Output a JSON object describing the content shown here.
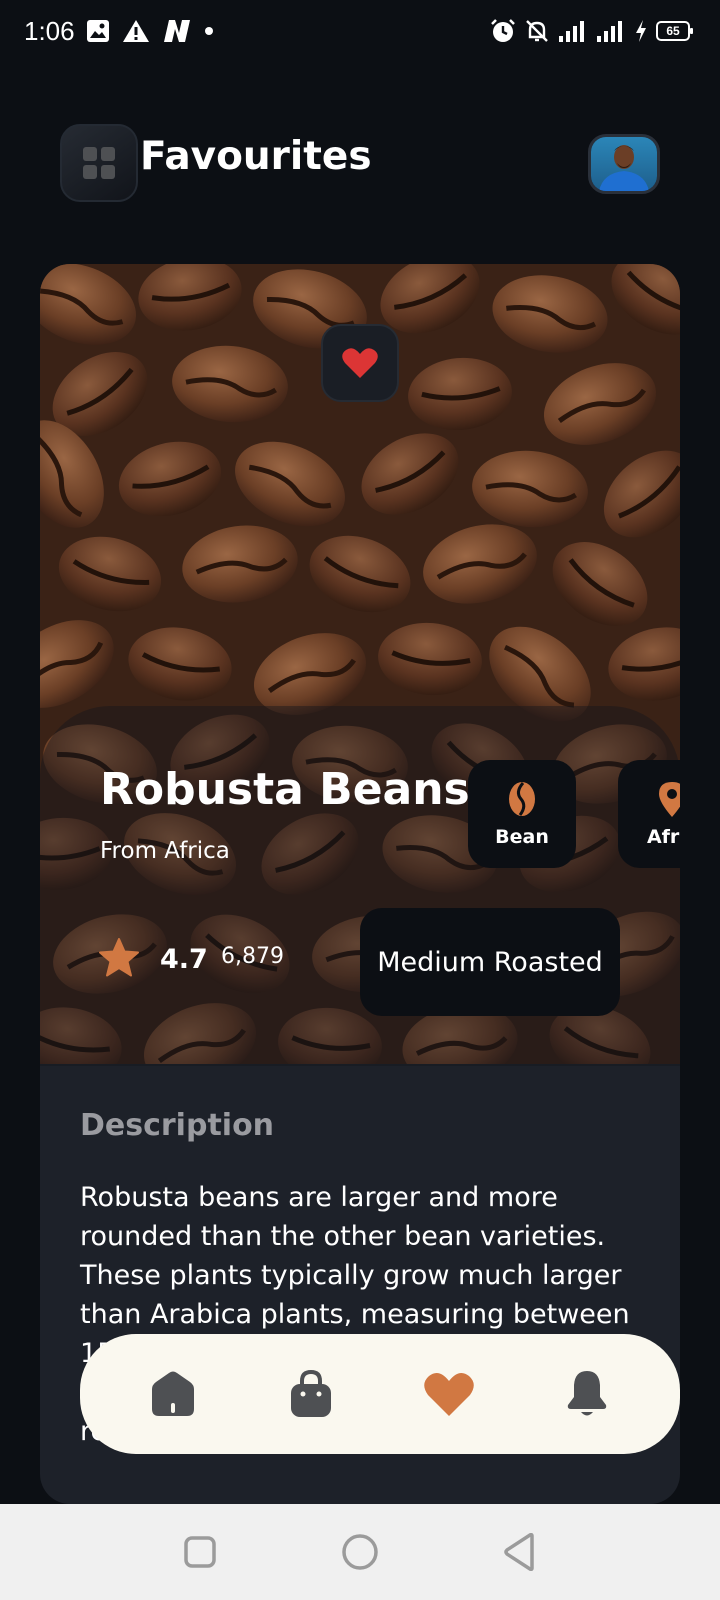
{
  "status_bar": {
    "time": "1:06",
    "battery": "65",
    "left_icons": [
      "image-icon",
      "alert-icon",
      "n-app-icon",
      "dot-icon"
    ],
    "right_icons": [
      "alarm-icon",
      "bell-off-icon",
      "signal-icon",
      "signal-icon",
      "charging-icon",
      "battery-icon"
    ]
  },
  "header": {
    "title": "Favourites",
    "menu_icon": "grid-menu-icon",
    "avatar_icon": "avatar"
  },
  "card": {
    "name": "Robusta Beans",
    "origin": "From Africa",
    "rating": "4.7",
    "rating_count": "6,879",
    "chips": [
      {
        "label": "Bean",
        "icon": "coffee-bean-icon"
      },
      {
        "label": "Afric",
        "icon": "location-pin-icon"
      }
    ],
    "roast": "Medium Roasted",
    "favourite_icon": "heart-icon",
    "description_heading": "Description",
    "description": "Robusta beans are larger and more rounded than the other bean varieties. These plants typically grow much larger than Arabica plants, measuring between 15 and 20 feet tall as they can be grown at lower altitudes and resist diseases. But recent research suggests that they don't"
  },
  "bottom_nav": [
    {
      "name": "home",
      "icon": "home-icon",
      "active": false
    },
    {
      "name": "cart",
      "icon": "shopping-bag-icon",
      "active": false
    },
    {
      "name": "favourites",
      "icon": "heart-icon",
      "active": true
    },
    {
      "name": "notifications",
      "icon": "bell-icon",
      "active": false
    }
  ],
  "colors": {
    "background": "#0c0f14",
    "accent": "#d17842",
    "nav_background": "#faf8ef",
    "nav_icon_inactive": "#4e5053",
    "heart_red": "#dc3535"
  }
}
